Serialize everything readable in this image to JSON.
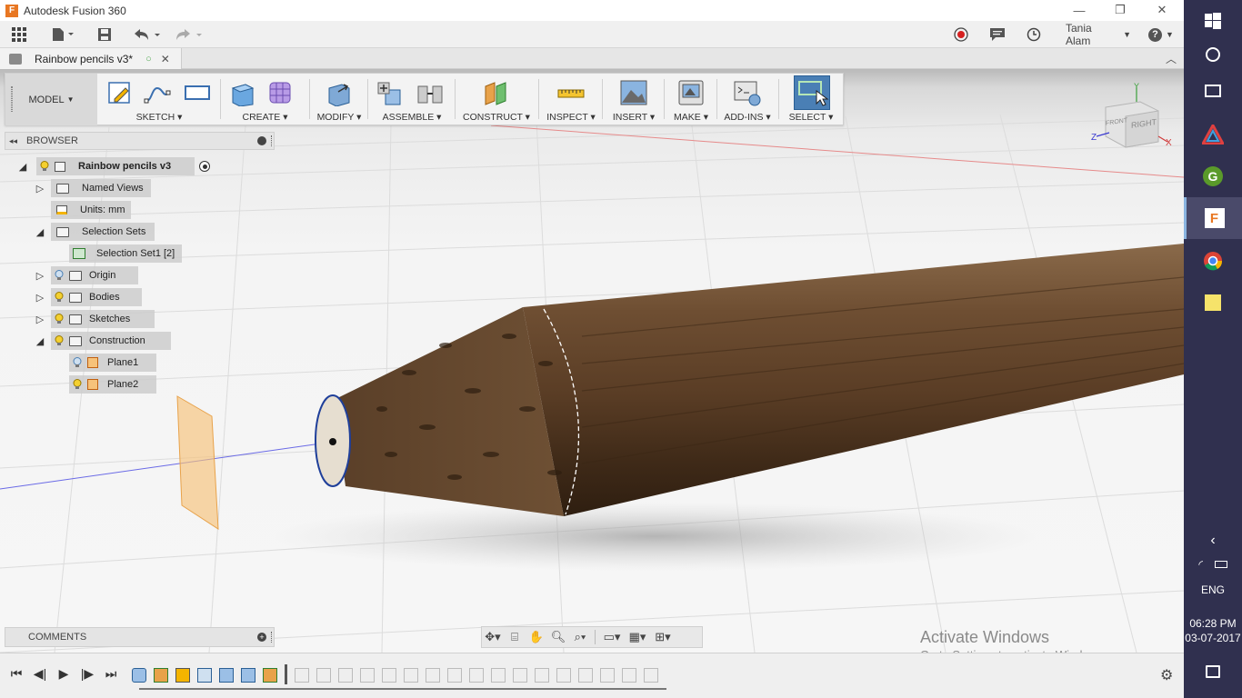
{
  "window": {
    "title": "Autodesk Fusion 360",
    "logo_letter": "F",
    "controls": {
      "minimize": "—",
      "maximize": "❐",
      "close": "✕"
    }
  },
  "app_toolbar": {
    "user": "Tania Alam",
    "help": "?"
  },
  "document_tab": {
    "label": "Rainbow pencils v3*"
  },
  "ribbon": {
    "workspace": "MODEL",
    "groups": [
      {
        "label": "SKETCH"
      },
      {
        "label": "CREATE"
      },
      {
        "label": "MODIFY"
      },
      {
        "label": "ASSEMBLE"
      },
      {
        "label": "CONSTRUCT"
      },
      {
        "label": "INSPECT"
      },
      {
        "label": "INSERT"
      },
      {
        "label": "MAKE"
      },
      {
        "label": "ADD-INS"
      },
      {
        "label": "SELECT"
      }
    ]
  },
  "browser": {
    "title": "BROWSER",
    "root": "Rainbow pencils v3",
    "nodes": {
      "named_views": "Named Views",
      "units": "Units: mm",
      "selection_sets": "Selection Sets",
      "selection_set1": "Selection Set1 [2]",
      "origin": "Origin",
      "bodies": "Bodies",
      "sketches": "Sketches",
      "construction": "Construction",
      "plane1": "Plane1",
      "plane2": "Plane2"
    }
  },
  "viewcube": {
    "front": "FRONT",
    "right": "RIGHT",
    "axis_y": "Y",
    "axis_z": "Z",
    "axis_x": "X"
  },
  "comments": {
    "title": "COMMENTS"
  },
  "watermark": {
    "line1": "Activate Windows",
    "line2": "Go to Settings to activate Windows."
  },
  "taskbar": {
    "language": "ENG",
    "time": "06:28 PM",
    "date": "03-07-2017"
  },
  "colors": {
    "accent": "#4a7fb5",
    "taskbar": "#30304f",
    "wood": "#6b4a2e",
    "fusion_orange": "#e87722"
  }
}
